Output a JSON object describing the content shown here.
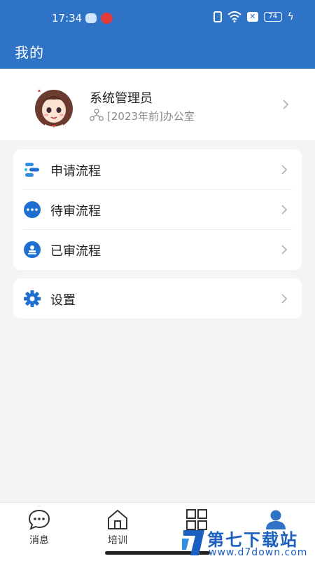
{
  "status_bar": {
    "time": "17:34",
    "battery": "74",
    "icons": [
      "cloud-app-icon",
      "red-app-icon",
      "vibrate-icon",
      "wifi-icon",
      "sim-x-icon",
      "battery-icon",
      "charging-icon"
    ]
  },
  "header": {
    "title": "我的"
  },
  "profile": {
    "name": "系统管理员",
    "org": "[2023年前]办公室",
    "icons": {
      "org": "org-tree-icon",
      "chevron": "chevron-right-icon"
    }
  },
  "menu": {
    "items": [
      {
        "label": "申请流程",
        "icon": "apply-flow-icon"
      },
      {
        "label": "待审流程",
        "icon": "pending-dots-icon"
      },
      {
        "label": "已审流程",
        "icon": "approved-stamp-icon"
      }
    ],
    "settings": {
      "label": "设置",
      "icon": "gear-icon"
    }
  },
  "tabbar": {
    "tabs": [
      {
        "label": "消息",
        "icon": "message-icon"
      },
      {
        "label": "培训",
        "icon": "home-icon"
      },
      {
        "label": "",
        "icon": "grid-icon"
      },
      {
        "label": "",
        "icon": "user-icon"
      }
    ],
    "active_color": "#2f73c7"
  },
  "watermark": {
    "title": "第七下载站",
    "url": "www.d7down.com"
  },
  "colors": {
    "primary": "#2f73c7",
    "background": "#f3f4f6"
  }
}
